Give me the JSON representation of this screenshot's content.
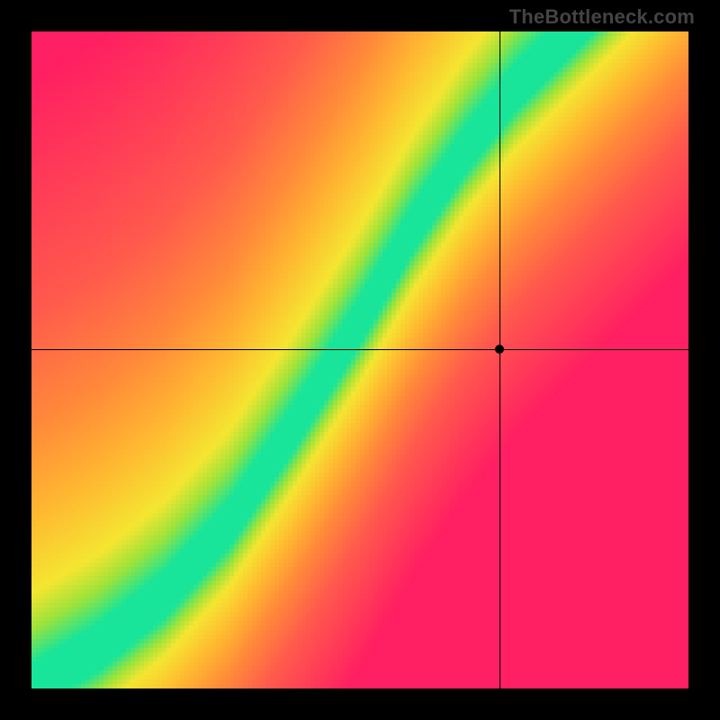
{
  "watermark": "TheBottleneck.com",
  "chart_data": {
    "type": "heatmap",
    "title": "",
    "xlabel": "",
    "ylabel": "",
    "xlim": [
      0,
      1
    ],
    "ylim": [
      0,
      1
    ],
    "grid_resolution": 146,
    "crosshair": {
      "x": 0.713,
      "y": 0.517
    },
    "ridge": {
      "description": "Center of green optimal band as y(x); piecewise-linear control points in normalized [0,1] coords (origin bottom-left).",
      "points": [
        [
          0.0,
          0.0
        ],
        [
          0.1,
          0.06
        ],
        [
          0.2,
          0.14
        ],
        [
          0.3,
          0.25
        ],
        [
          0.4,
          0.4
        ],
        [
          0.5,
          0.56
        ],
        [
          0.58,
          0.7
        ],
        [
          0.66,
          0.82
        ],
        [
          0.74,
          0.92
        ],
        [
          0.82,
          1.0
        ]
      ],
      "band_half_width": 0.035
    },
    "colorscale": {
      "description": "Distance from ridge mapped through stops; 0=on ridge",
      "stops": [
        [
          0.0,
          "#18e59a"
        ],
        [
          0.06,
          "#9fe33a"
        ],
        [
          0.12,
          "#f5e631"
        ],
        [
          0.25,
          "#ffb931"
        ],
        [
          0.4,
          "#ff8a3a"
        ],
        [
          0.6,
          "#ff5a4d"
        ],
        [
          1.0,
          "#ff1f62"
        ]
      ]
    },
    "asymmetry": {
      "description": "Scale factor applied to distance on the side BELOW the ridge (GPU-underpowered side falls to red faster).",
      "below_ridge_distance_scale": 1.8
    }
  }
}
